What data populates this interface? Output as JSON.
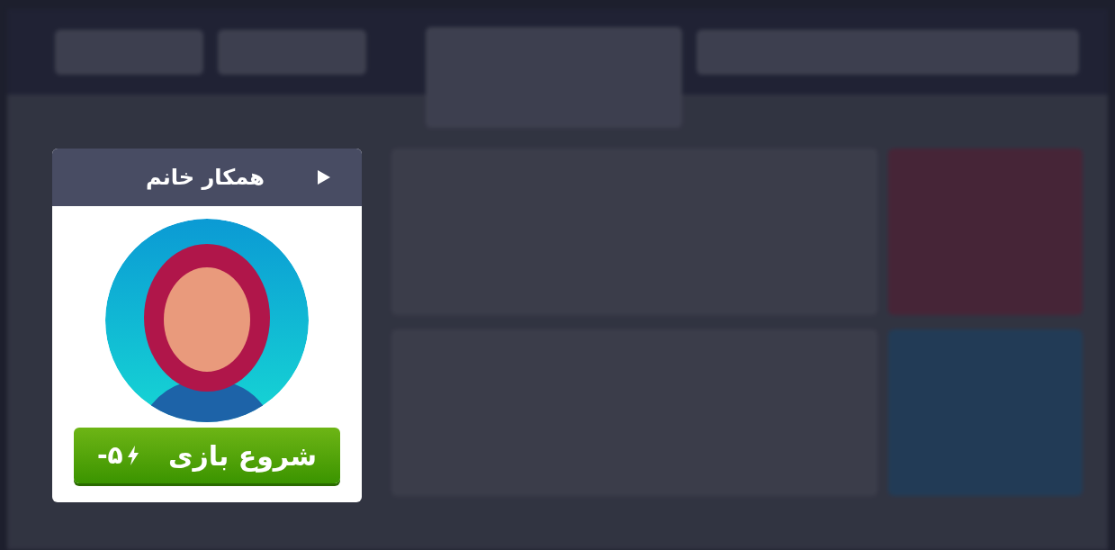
{
  "modal": {
    "title": "همکار خانم",
    "start_button": {
      "label": "شروع بازی",
      "cost": "-۵"
    }
  }
}
